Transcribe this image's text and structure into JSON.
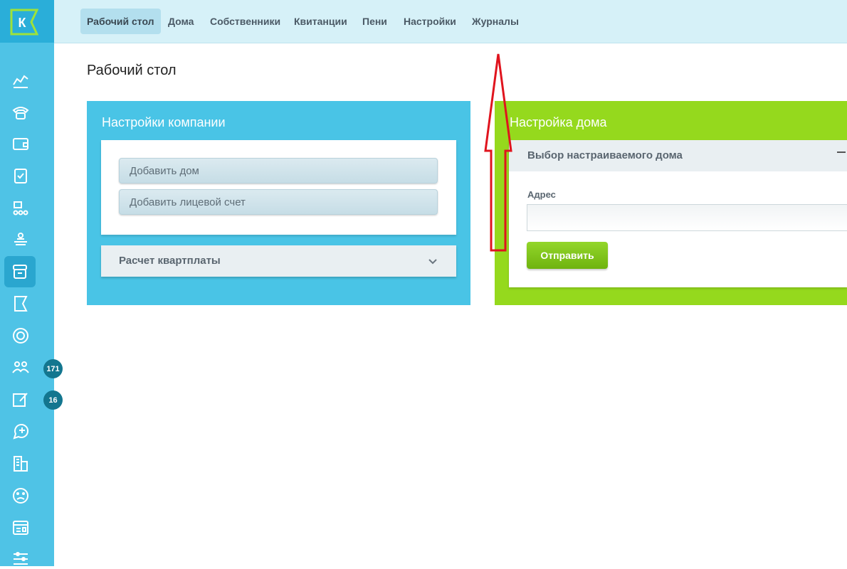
{
  "sidebar": {
    "logo_letter": "К",
    "icons": [
      "analytics-icon",
      "phone-icon",
      "wallet-icon",
      "clipboard-check-icon",
      "org-chart-icon",
      "cashier-icon",
      "archive-icon",
      "flag-icon",
      "coin-icon",
      "community-icon",
      "note-edit-icon",
      "chat-add-icon",
      "building-icon",
      "sad-face-icon",
      "dashboard-icon",
      "sliders-icon"
    ],
    "badges": {
      "community": "171",
      "notes": "16"
    }
  },
  "nav": {
    "items": [
      "Рабочий стол",
      "Дома",
      "Собственники",
      "Квитанции",
      "Пени",
      "Настройки",
      "Журналы"
    ],
    "active": "Рабочий стол"
  },
  "page": {
    "title": "Рабочий стол"
  },
  "company_card": {
    "title": "Настройки компании",
    "buttons": [
      "Добавить дом",
      "Добавить лицевой счет"
    ],
    "collapsed_section": "Расчет квартплаты"
  },
  "house_card": {
    "title": "Настройка дома",
    "panel_title": "Выбор настраиваемого дома",
    "address_label": "Адрес",
    "address_value": "",
    "submit_label": "Отправить"
  },
  "colors": {
    "sidebar": "#4fc3e6",
    "nav_bg": "#d6f1f8",
    "company_card": "#49c4e6",
    "house_card": "#95d91d",
    "submit": "#7cc41a",
    "annotation_arrow": "#e0141e"
  }
}
